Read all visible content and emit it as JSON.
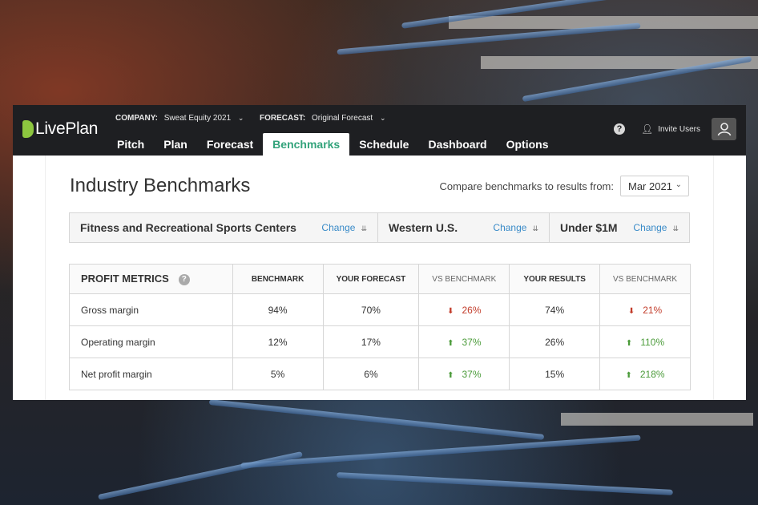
{
  "app": {
    "logo_text": "LivePlan",
    "brand_color": "#8dc63f",
    "accent_color": "#33a37b"
  },
  "header": {
    "company_label": "COMPANY:",
    "company_value": "Sweat Equity 2021",
    "forecast_label": "FORECAST:",
    "forecast_value": "Original Forecast",
    "invite_label": "Invite Users",
    "help_icon": "help-icon",
    "nav": [
      {
        "label": "Pitch"
      },
      {
        "label": "Plan"
      },
      {
        "label": "Forecast"
      },
      {
        "label": "Benchmarks",
        "active": true
      },
      {
        "label": "Schedule"
      },
      {
        "label": "Dashboard"
      },
      {
        "label": "Options"
      }
    ]
  },
  "page": {
    "title": "Industry Benchmarks",
    "compare_label": "Compare benchmarks to results from:",
    "compare_value": "Mar 2021"
  },
  "filters": [
    {
      "value": "Fitness and Recreational Sports Centers ...",
      "change": "Change"
    },
    {
      "value": "Western U.S.",
      "change": "Change"
    },
    {
      "value": "Under $1M",
      "change": "Change"
    }
  ],
  "table": {
    "headers": [
      "PROFIT METRICS",
      "BENCHMARK",
      "YOUR FORECAST",
      "VS BENCHMARK",
      "YOUR RESULTS",
      "VS BENCHMARK"
    ],
    "rows": [
      {
        "metric": "Gross margin",
        "benchmark": "94%",
        "forecast": "70%",
        "vs_forecast": "26%",
        "vs_forecast_dir": "down",
        "results": "74%",
        "vs_results": "21%",
        "vs_results_dir": "down"
      },
      {
        "metric": "Operating margin",
        "benchmark": "12%",
        "forecast": "17%",
        "vs_forecast": "37%",
        "vs_forecast_dir": "up",
        "results": "26%",
        "vs_results": "110%",
        "vs_results_dir": "up"
      },
      {
        "metric": "Net profit margin",
        "benchmark": "5%",
        "forecast": "6%",
        "vs_forecast": "37%",
        "vs_forecast_dir": "up",
        "results": "15%",
        "vs_results": "218%",
        "vs_results_dir": "up"
      }
    ]
  }
}
